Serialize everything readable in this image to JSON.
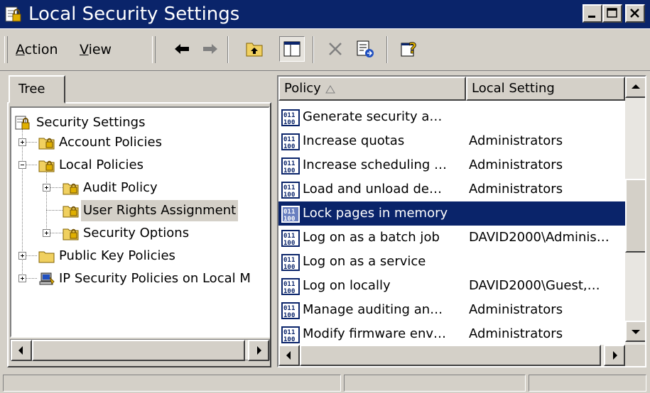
{
  "window": {
    "title": "Local Security Settings"
  },
  "menu": {
    "action": "Action",
    "action_mnemonic": "A",
    "action_rest": "ction",
    "view": "View",
    "view_mnemonic": "V",
    "view_rest": "iew"
  },
  "tree": {
    "tab_label": "Tree",
    "items": [
      {
        "label": "Security Settings",
        "icon": "security-settings-icon"
      },
      {
        "label": "Account Policies",
        "icon": "policy-folder-icon",
        "expander": "plus"
      },
      {
        "label": "Local Policies",
        "icon": "policy-folder-icon",
        "expander": "minus"
      },
      {
        "label": "Audit Policy",
        "icon": "policy-folder-icon",
        "expander": "plus"
      },
      {
        "label": "User Rights Assignment",
        "icon": "policy-folder-icon",
        "selected": true
      },
      {
        "label": "Security Options",
        "icon": "policy-folder-icon",
        "expander": "plus"
      },
      {
        "label": "Public Key Policies",
        "icon": "folder-icon",
        "expander": "plus"
      },
      {
        "label": "IP Security Policies on Local M",
        "icon": "ip-security-icon",
        "expander": "plus"
      }
    ]
  },
  "list": {
    "columns": {
      "policy": "Policy",
      "setting": "Local Setting"
    },
    "rows": [
      {
        "policy": "Generate security a…",
        "setting": ""
      },
      {
        "policy": "Increase quotas",
        "setting": "Administrators"
      },
      {
        "policy": "Increase scheduling …",
        "setting": "Administrators"
      },
      {
        "policy": "Load and unload de…",
        "setting": "Administrators"
      },
      {
        "policy": "Lock pages in memory",
        "setting": "",
        "selected": true
      },
      {
        "policy": "Log on as a batch job",
        "setting": "DAVID2000\\Adminis…"
      },
      {
        "policy": "Log on as a service",
        "setting": ""
      },
      {
        "policy": "Log on locally",
        "setting": "DAVID2000\\Guest,…"
      },
      {
        "policy": "Manage auditing an…",
        "setting": "Administrators"
      },
      {
        "policy": "Modify firmware env…",
        "setting": "Administrators"
      }
    ]
  },
  "colors": {
    "titlebar": "#0a246a",
    "selection": "#0a246a",
    "face": "#d4d0c8"
  }
}
